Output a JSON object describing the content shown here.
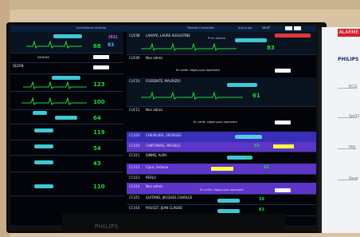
{
  "brand": "PHILIPS",
  "header": {
    "left": "Surveillance centrale",
    "center": "Patients Connectés",
    "right": "Aucun bip",
    "time": "15:57"
  },
  "sidebar": {
    "brand": "PHILIPS",
    "alarm": "ALARME",
    "labels": [
      "ECG",
      "SpO2",
      "PNI",
      "Resp"
    ]
  },
  "left_panel": [
    {
      "bed": "",
      "name": "",
      "hr": "68",
      "bp": "83",
      "mv": "(92)"
    },
    {
      "bed": "",
      "name": "Sérénité",
      "hr": "",
      "bp": "",
      "mv": ""
    },
    {
      "bed": "",
      "name": "SEZAN",
      "hr": "123",
      "bp": "",
      "mv": ""
    },
    {
      "bed": "",
      "name": "",
      "hr": "100",
      "bp": "",
      "mv": ""
    },
    {
      "bed": "",
      "name": "",
      "hr": "64",
      "bp": "",
      "mv": ""
    },
    {
      "bed": "",
      "name": "",
      "hr": "119",
      "bp": "",
      "mv": ""
    },
    {
      "bed": "",
      "name": "",
      "hr": "54",
      "bp": "",
      "mv": ""
    },
    {
      "bed": "",
      "name": "",
      "hr": "43",
      "bp": "",
      "mv": ""
    },
    {
      "bed": "",
      "name": "",
      "hr": "110",
      "bp": "",
      "mv": ""
    }
  ],
  "right_panel": [
    {
      "bed": "CUC08",
      "name": "LAHAYE, LAURE AUGUSTINE",
      "hr": "83",
      "status": "PI en alarme"
    },
    {
      "bed": "CUC09",
      "name": "Non admis",
      "hr": "",
      "status": "En veille. Lèges pour reprendre"
    },
    {
      "bed": "CUC10",
      "name": "FOSSENTE, MAURIZIO",
      "hr": "61",
      "status": ""
    },
    {
      "bed": "CUC11",
      "name": "Non admis",
      "hr": "",
      "status": "En veille. Lèges pour reprendre"
    },
    {
      "bed": "CCU20",
      "name": "CHEVALIER, GEORGES",
      "hr": "",
      "status": ""
    },
    {
      "bed": "CCU10",
      "name": "CANTONAIS, MICHELE",
      "hr": "53",
      "status": ""
    },
    {
      "bed": "CCU11",
      "name": "SIMMS, ALPH",
      "hr": "42",
      "status": ""
    },
    {
      "bed": "CCU12",
      "name": "Cipro, Antoine",
      "hr": "62",
      "status": ""
    },
    {
      "bed": "CCU13",
      "name": "PERLU",
      "hr": "",
      "status": ""
    },
    {
      "bed": "CCU14",
      "name": "Non admis",
      "hr": "",
      "status": "En veille. Lèges pour reprendre"
    },
    {
      "bed": "CCU15",
      "name": "GUITAND, JACQUES CHARLES",
      "hr": "58",
      "status": ""
    },
    {
      "bed": "CCU16",
      "name": "POUCET, JEAN CLAUDE",
      "hr": "81",
      "status": ""
    }
  ]
}
